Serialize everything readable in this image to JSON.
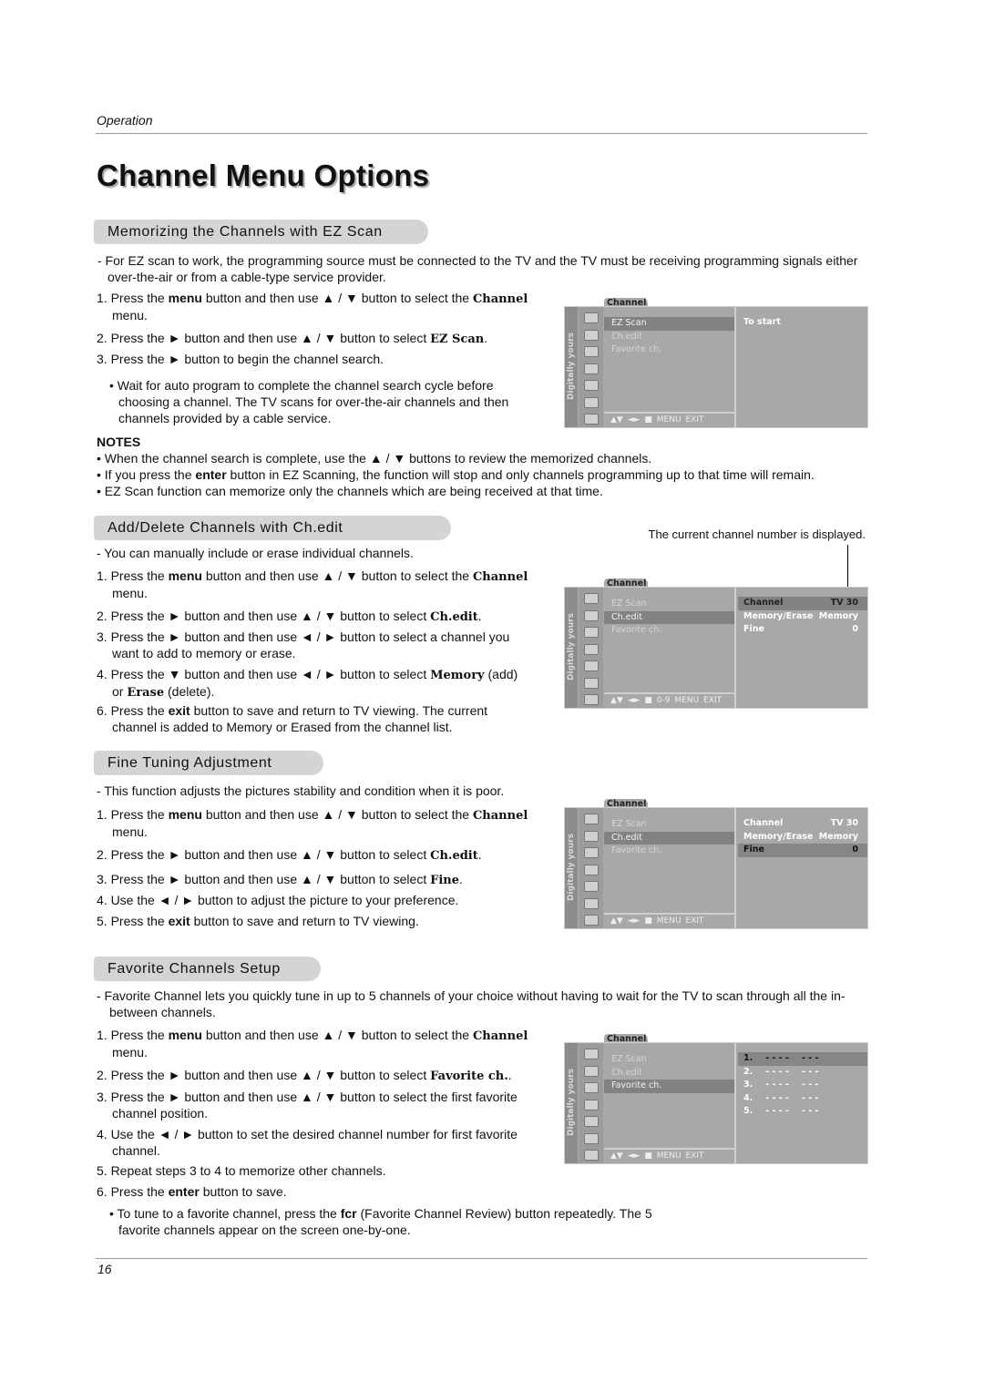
{
  "header": {
    "running": "Operation",
    "title": "Channel Menu Options",
    "page_number": "16"
  },
  "sections": [
    {
      "heading": "Memorizing the Channels with EZ Scan",
      "intro": "- For EZ scan to work, the programming source must be connected to the TV and the TV must be receiving programming signals either over-the-air or from a cable-type service provider.",
      "steps": [
        [
          [
            "1. Press the ",
            ""
          ],
          [
            "menu",
            "b"
          ],
          [
            " button and then use ▲ / ▼ button to select the ",
            ""
          ],
          [
            "Channel",
            "k"
          ],
          [
            " menu.",
            ""
          ]
        ],
        [
          [
            "2. Press the ► button and then use ▲ / ▼ button to select ",
            ""
          ],
          [
            "EZ Scan",
            "k"
          ],
          [
            ".",
            ""
          ]
        ],
        [
          [
            "3. Press the ► button to begin the channel search.",
            ""
          ]
        ]
      ],
      "bullet": "• Wait for auto program to complete the channel search cycle before choosing a channel. The TV scans for over-the-air channels and then channels provided by a cable service.",
      "notes_title": "NOTES",
      "notes": [
        [
          [
            "• When the channel search is complete, use the ▲ / ▼ buttons to review the memorized channels.",
            ""
          ]
        ],
        [
          [
            "• If you press the ",
            ""
          ],
          [
            "enter",
            "b"
          ],
          [
            " button in EZ Scanning, the function will stop and only channels programming up to that time will remain.",
            ""
          ]
        ],
        [
          [
            "• EZ Scan function can memorize only the channels which are being received at that time.",
            ""
          ]
        ]
      ]
    },
    {
      "heading": "Add/Delete Channels with Ch.edit",
      "caption": "The current channel number is displayed.",
      "intro": "-  You can manually include or erase individual channels.",
      "steps": [
        [
          [
            "1. Press the ",
            ""
          ],
          [
            "menu",
            "b"
          ],
          [
            " button and then use ▲ / ▼ button to select the ",
            ""
          ],
          [
            "Channel",
            "k"
          ],
          [
            " menu.",
            ""
          ]
        ],
        [
          [
            "2. Press the ► button and then use ▲ / ▼ button to select ",
            ""
          ],
          [
            "Ch.edit",
            "k"
          ],
          [
            ".",
            ""
          ]
        ],
        [
          [
            "3. Press the ► button and then use ◄ / ► button to select a channel you want to add to memory or erase.",
            ""
          ]
        ],
        [
          [
            "4. Press the ▼ button and then use ◄ / ► button to select ",
            ""
          ],
          [
            "Memory",
            "k"
          ],
          [
            " (add) or ",
            ""
          ],
          [
            "Erase",
            "k"
          ],
          [
            " (delete).",
            ""
          ]
        ],
        [
          [
            "6. Press the ",
            ""
          ],
          [
            "exit",
            "b"
          ],
          [
            " button to save and return to TV viewing. The current channel is added to Memory or Erased from the channel list.",
            ""
          ]
        ]
      ]
    },
    {
      "heading": "Fine Tuning Adjustment",
      "intro": "-  This function adjusts the pictures stability and condition when it is poor.",
      "steps": [
        [
          [
            "1. Press the ",
            ""
          ],
          [
            "menu",
            "b"
          ],
          [
            " button and then use ▲ / ▼ button to select the ",
            ""
          ],
          [
            "Channel",
            "k"
          ],
          [
            " menu.",
            ""
          ]
        ],
        [
          [
            "2. Press the ► button and then use ▲ / ▼ button to select ",
            ""
          ],
          [
            "Ch.edit",
            "k"
          ],
          [
            ".",
            ""
          ]
        ],
        [
          [
            "3. Press the ► button and then use ▲ / ▼ button to select ",
            ""
          ],
          [
            "Fine",
            "k"
          ],
          [
            ".",
            ""
          ]
        ],
        [
          [
            "4. Use the ◄ / ► button to adjust the picture to your preference.",
            ""
          ]
        ],
        [
          [
            "5. Press the ",
            ""
          ],
          [
            "exit",
            "b"
          ],
          [
            " button to save and return to TV viewing.",
            ""
          ]
        ]
      ]
    },
    {
      "heading": "Favorite Channels Setup",
      "intro": "-  Favorite Channel lets you quickly tune in up to 5 channels of your choice without having to wait for the TV to scan through all the in-between channels.",
      "steps": [
        [
          [
            "1. Press the ",
            ""
          ],
          [
            "menu",
            "b"
          ],
          [
            " button and then use ▲ / ▼ button to select the ",
            ""
          ],
          [
            "Channel",
            "k"
          ],
          [
            " menu.",
            ""
          ]
        ],
        [
          [
            "2. Press the ► button and then use ▲ / ▼ button to select ",
            ""
          ],
          [
            "Favorite ch.",
            "k"
          ],
          [
            ".",
            ""
          ]
        ],
        [
          [
            "3. Press the ► button and then use ▲ / ▼ button to select the first favorite channel position.",
            ""
          ]
        ],
        [
          [
            "4. Use the ◄ / ► button to set the desired channel number for first favorite channel.",
            ""
          ]
        ],
        [
          [
            "5. Repeat steps 3 to 4 to memorize other channels.",
            ""
          ]
        ],
        [
          [
            "6. Press the ",
            ""
          ],
          [
            "enter",
            "b"
          ],
          [
            " button to save.",
            ""
          ]
        ]
      ],
      "bullet": [
        [
          "• To tune to a favorite channel, press the ",
          ""
        ],
        [
          "fcr",
          "b"
        ],
        [
          " (Favorite Channel Review) button repeatedly. The 5 favorite channels appear on the screen one-by-one.",
          ""
        ]
      ]
    }
  ],
  "menus": [
    {
      "tab": "Channel",
      "side": "Digitally yours",
      "items": [
        "EZ Scan",
        "Ch.edit",
        "Favorite ch."
      ],
      "selected": 0,
      "bar": "▲▼ ◄► ■      MENU  EXIT",
      "rows": [
        {
          "l": "To start",
          "r": ""
        }
      ],
      "row_sel": -1,
      "row_hl": -1
    },
    {
      "tab": "Channel",
      "side": "Digitally yours",
      "items": [
        "EZ Scan",
        "Ch.edit",
        "Favorite ch."
      ],
      "selected": 1,
      "bar": "▲▼ ◄► ■  0-9  MENU  EXIT",
      "rows": [
        {
          "l": "Channel",
          "r": "TV 30"
        },
        {
          "l": "Memory/Erase",
          "r": "Memory"
        },
        {
          "l": "Fine",
          "r": "0"
        }
      ],
      "row_sel": 0,
      "row_hl": -1
    },
    {
      "tab": "Channel",
      "side": "Digitally yours",
      "items": [
        "EZ Scan",
        "Ch.edit",
        "Favorite ch."
      ],
      "selected": 1,
      "bar": "▲▼ ◄► ■      MENU  EXIT",
      "rows": [
        {
          "l": "Channel",
          "r": "TV 30"
        },
        {
          "l": "Memory/Erase",
          "r": "Memory"
        },
        {
          "l": "Fine",
          "r": "0"
        }
      ],
      "row_sel": -1,
      "row_hl": 2
    },
    {
      "tab": "Channel",
      "side": "Digitally yours",
      "items": [
        "EZ Scan",
        "Ch.edit",
        "Favorite ch."
      ],
      "selected": 2,
      "bar": "▲▼ ◄► ■      MENU  EXIT",
      "fav": [
        [
          "1.",
          "- - - -",
          "- - -"
        ],
        [
          "2.",
          "- - - -",
          "- - -"
        ],
        [
          "3.",
          "- - - -",
          "- - -"
        ],
        [
          "4.",
          "- - - -",
          "- - -"
        ],
        [
          "5.",
          "- - - -",
          "- - -"
        ]
      ],
      "row_sel": 0,
      "row_hl": -1
    }
  ],
  "colors": {
    "section_pill": "#d4d4d4",
    "menu_bg": "#a8a8a8",
    "menu_selected": "#828282"
  }
}
